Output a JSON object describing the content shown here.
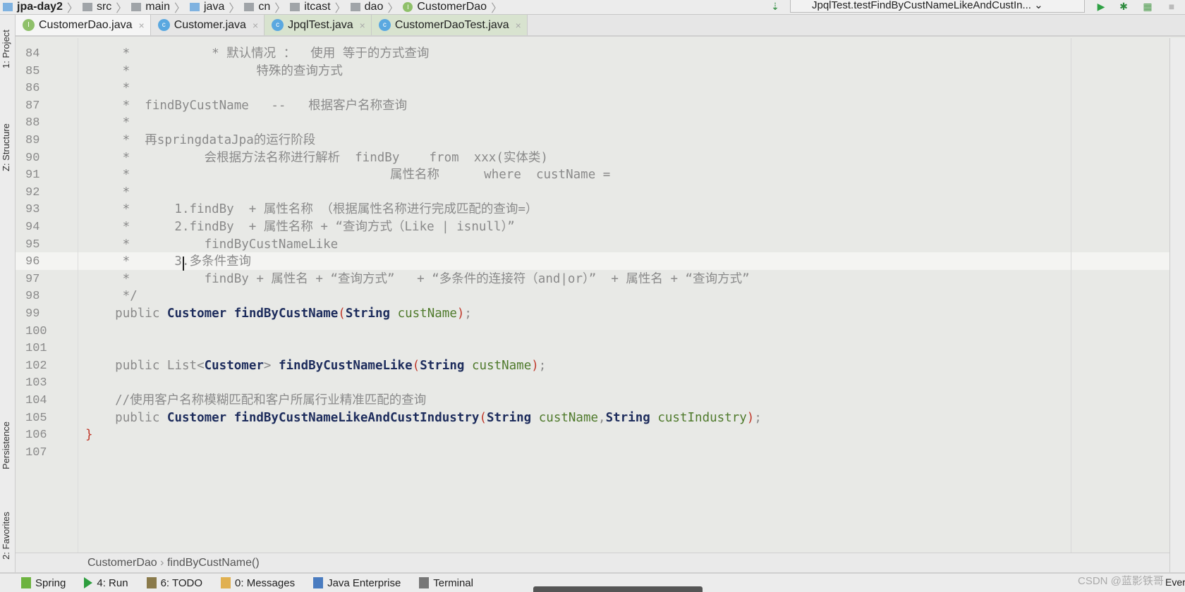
{
  "navbar": {
    "crumbs": [
      "jpa-day2",
      "src",
      "main",
      "java",
      "cn",
      "itcast",
      "dao",
      "CustomerDao"
    ],
    "run_config": "JpqlTest.testFindByCustNameLikeAndCustIn...",
    "icons": [
      "sort-icon",
      "run-icon",
      "debug-icon",
      "coverage-icon"
    ]
  },
  "tabs": [
    {
      "label": "CustomerDao.java",
      "kind": "interface",
      "active": true
    },
    {
      "label": "Customer.java",
      "kind": "class"
    },
    {
      "label": "JpqlTest.java",
      "kind": "test-class"
    },
    {
      "label": "CustomerDaoTest.java",
      "kind": "test-class"
    }
  ],
  "left_tools": [
    "1: Project",
    "Z: Structure",
    "Persistence",
    "2: Favorites"
  ],
  "editor": {
    "current_line": 96,
    "lines": [
      {
        "n": "84",
        "t": "     *           * 默认情况 ：  使用 等于的方式查询"
      },
      {
        "n": "85",
        "t": "     *                 特殊的查询方式"
      },
      {
        "n": "86",
        "t": "     *"
      },
      {
        "n": "87",
        "t": "     *  findByCustName   --   根据客户名称查询"
      },
      {
        "n": "88",
        "t": "     *"
      },
      {
        "n": "89",
        "t": "     *  再springdataJpa的运行阶段"
      },
      {
        "n": "90",
        "t": "     *          会根据方法名称进行解析  findBy    from  xxx(实体类)"
      },
      {
        "n": "91",
        "t": "     *                                   属性名称      where  custName ="
      },
      {
        "n": "92",
        "t": "     *"
      },
      {
        "n": "93",
        "t": "     *      1.findBy  + 属性名称 （根据属性名称进行完成匹配的查询=）"
      },
      {
        "n": "94",
        "t": "     *      2.findBy  + 属性名称 + “查询方式（Like | isnull）”"
      },
      {
        "n": "95",
        "t": "     *          findByCustNameLike"
      },
      {
        "n": "96",
        "t": "     *      3.多条件查询"
      },
      {
        "n": "97",
        "t": "     *          findBy + 属性名 + “查询方式”   + “多条件的连接符（and|or）”  + 属性名 + “查询方式”"
      },
      {
        "n": "98",
        "t": "     */"
      },
      {
        "n": "99",
        "code": [
          [
            "    ",
            "kw"
          ],
          [
            "public ",
            "kw"
          ],
          [
            "Customer ",
            "ty"
          ],
          [
            "findByCustName",
            "fn"
          ],
          [
            "(",
            "br"
          ],
          [
            "String ",
            "ty"
          ],
          [
            "custName",
            "pr"
          ],
          [
            ")",
            "br"
          ],
          [
            ";",
            "kw"
          ]
        ]
      },
      {
        "n": "100",
        "t": ""
      },
      {
        "n": "101",
        "t": ""
      },
      {
        "n": "102",
        "code": [
          [
            "    ",
            "kw"
          ],
          [
            "public ",
            "kw"
          ],
          [
            "List<",
            "kw"
          ],
          [
            "Customer",
            "ty"
          ],
          [
            "> ",
            "kw"
          ],
          [
            "findByCustNameLike",
            "fn"
          ],
          [
            "(",
            "br"
          ],
          [
            "String ",
            "ty"
          ],
          [
            "custName",
            "pr"
          ],
          [
            ")",
            "br"
          ],
          [
            ";",
            "kw"
          ]
        ]
      },
      {
        "n": "103",
        "t": ""
      },
      {
        "n": "104",
        "t": "    //使用客户名称模糊匹配和客户所属行业精准匹配的查询"
      },
      {
        "n": "105",
        "code": [
          [
            "    ",
            "kw"
          ],
          [
            "public ",
            "kw"
          ],
          [
            "Customer ",
            "ty"
          ],
          [
            "findByCustNameLikeAndCustIndustry",
            "fn"
          ],
          [
            "(",
            "br"
          ],
          [
            "String ",
            "ty"
          ],
          [
            "custName",
            "pr"
          ],
          [
            ",",
            "kw"
          ],
          [
            "String ",
            "ty"
          ],
          [
            "custIndustry",
            "pr"
          ],
          [
            ")",
            "br"
          ],
          [
            ";",
            "kw"
          ]
        ]
      },
      {
        "n": "106",
        "code": [
          [
            "}",
            "br"
          ]
        ]
      },
      {
        "n": "107",
        "t": ""
      }
    ]
  },
  "breadcrumb": {
    "class": "CustomerDao",
    "method": "findByCustName()"
  },
  "bottom_tools": [
    {
      "label": "Spring",
      "icon": "spring-icon",
      "color": "#6db33f"
    },
    {
      "label": "4: Run",
      "icon": "run-icon",
      "color": "#2e9e3e"
    },
    {
      "label": "6: TODO",
      "icon": "todo-icon",
      "color": "#8a7a4a"
    },
    {
      "label": "0: Messages",
      "icon": "messages-icon",
      "color": "#e0b050"
    },
    {
      "label": "Java Enterprise",
      "icon": "java-enterprise-icon",
      "color": "#4a7cc0"
    },
    {
      "label": "Terminal",
      "icon": "terminal-icon",
      "color": "#777777"
    }
  ],
  "watermark": "CSDN @蓝影铁哥",
  "event_log": "Ever"
}
